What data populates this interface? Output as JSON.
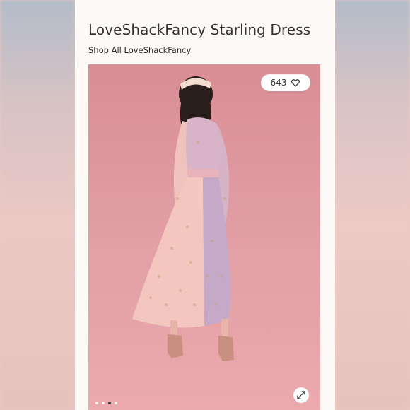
{
  "product": {
    "title": "LoveShackFancy Starling Dress",
    "shop_link": "Shop All LoveShackFancy"
  },
  "photo": {
    "likes": "643",
    "carousel": {
      "total": 4,
      "active": 3
    }
  },
  "colors": {
    "backdrop": "#e3a0a6",
    "card": "#fdf9f7",
    "dress_pink": "#f1c2bd",
    "dress_lavender": "#c6a9c9"
  },
  "icons": {
    "likes": "heart-icon",
    "expand": "expand-icon"
  }
}
